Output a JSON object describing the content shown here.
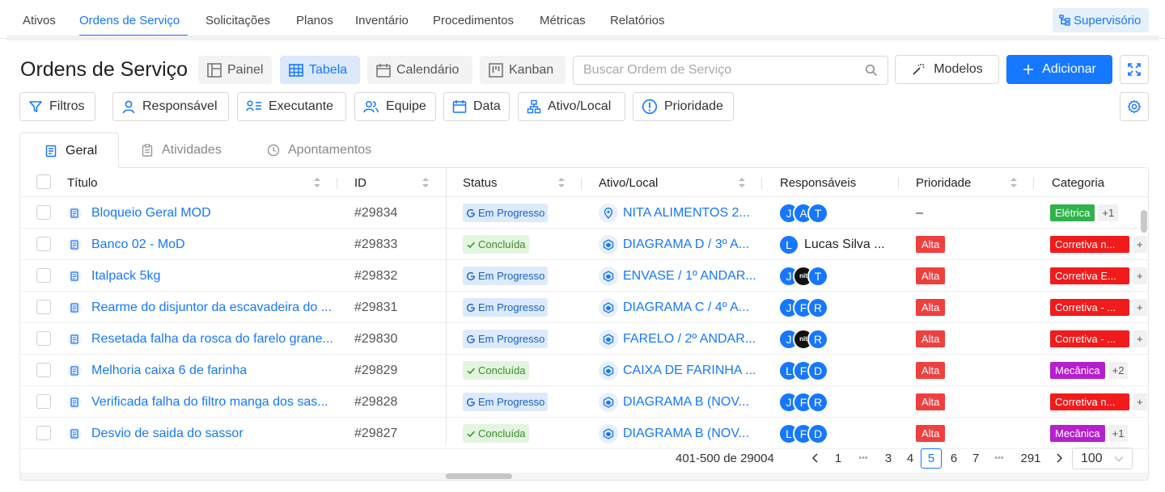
{
  "topnav": {
    "items": [
      "Ativos",
      "Ordens de Serviço",
      "Solicitações",
      "Planos",
      "Inventário",
      "Procedimentos",
      "Métricas",
      "Relatórios"
    ],
    "active": "Ordens de Serviço",
    "supervisor_label": "Supervisório"
  },
  "header": {
    "title": "Ordens de Serviço",
    "views": [
      "Painel",
      "Tabela",
      "Calendário",
      "Kanban"
    ],
    "active_view": "Tabela",
    "search_placeholder": "Buscar Ordem de Serviço",
    "models_label": "Modelos",
    "add_label": "Adicionar"
  },
  "filters": [
    "Filtros",
    "Responsável",
    "Executante",
    "Equipe",
    "Data",
    "Ativo/Local",
    "Prioridade"
  ],
  "tabs": [
    "Geral",
    "Atividades",
    "Apontamentos"
  ],
  "table": {
    "columns": [
      "Título",
      "ID",
      "Status",
      "Ativo/Local",
      "Responsáveis",
      "Prioridade",
      "Categoria"
    ],
    "rows": [
      {
        "title": "Bloqueio Geral MOD",
        "id": "#29834",
        "status": "Em Progresso",
        "asset": "NITA ALIMENTOS 2...",
        "asset_icon": "location-pin",
        "avatars": [
          "J",
          "A",
          "T"
        ],
        "avatar_name": "",
        "priority": "–",
        "category": "Elétrica",
        "category_type": "eletrica",
        "more": "+1"
      },
      {
        "title": "Banco 02 - MoD",
        "id": "#29833",
        "status": "Concluída",
        "asset": "DIAGRAMA D / 3º A...",
        "asset_icon": "asset-cube",
        "avatars": [
          "L"
        ],
        "avatar_name": "Lucas Silva ...",
        "priority": "Alta",
        "category": "Corretiva n...",
        "category_type": "corretiva",
        "more": "+"
      },
      {
        "title": "Italpack 5kg",
        "id": "#29832",
        "status": "Em Progresso",
        "asset": "ENVASE / 1º ANDAR...",
        "asset_icon": "asset-cube",
        "avatars": [
          "J",
          "nit",
          "T"
        ],
        "avatar_name": "",
        "priority": "Alta",
        "category": "Corretiva E...",
        "category_type": "corretiva",
        "more": "+"
      },
      {
        "title": "Rearme do disjuntor da escavadeira do ...",
        "id": "#29831",
        "status": "Em Progresso",
        "asset": "DIAGRAMA C / 4º A...",
        "asset_icon": "asset-cube",
        "avatars": [
          "J",
          "F",
          "R"
        ],
        "avatar_name": "",
        "priority": "Alta",
        "category": "Corretiva - ...",
        "category_type": "corretiva",
        "more": "+"
      },
      {
        "title": "Resetada falha da rosca do farelo grane...",
        "id": "#29830",
        "status": "Em Progresso",
        "asset": "FARELO / 2º ANDAR...",
        "asset_icon": "asset-cube",
        "avatars": [
          "J",
          "nit",
          "R"
        ],
        "avatar_name": "",
        "priority": "Alta",
        "category": "Corretiva - ...",
        "category_type": "corretiva",
        "more": "+"
      },
      {
        "title": "Melhoria caixa 6 de farinha",
        "id": "#29829",
        "status": "Concluída",
        "asset": "CAIXA DE FARINHA ...",
        "asset_icon": "asset-cube",
        "avatars": [
          "L",
          "F",
          "D"
        ],
        "avatar_name": "",
        "priority": "Alta",
        "category": "Mecânica",
        "category_type": "mecanica",
        "more": "+2"
      },
      {
        "title": "Verificada falha do filtro manga dos sas...",
        "id": "#29828",
        "status": "Em Progresso",
        "asset": "DIAGRAMA B (NOV...",
        "asset_icon": "asset-cube",
        "avatars": [
          "J",
          "F",
          "R"
        ],
        "avatar_name": "",
        "priority": "Alta",
        "category": "Corretiva n...",
        "category_type": "corretiva",
        "more": "+"
      },
      {
        "title": "Desvio de saida do sassor",
        "id": "#29827",
        "status": "Concluída",
        "asset": "DIAGRAMA B (NOV...",
        "asset_icon": "asset-cube",
        "avatars": [
          "L",
          "F",
          "D"
        ],
        "avatar_name": "",
        "priority": "Alta",
        "category": "Mecânica",
        "category_type": "mecanica",
        "more": "+1"
      }
    ]
  },
  "pagination": {
    "range": "401-500 de 29004",
    "pages": [
      "1",
      "•••",
      "3",
      "4",
      "5",
      "6",
      "7",
      "•••",
      "291"
    ],
    "current": "5",
    "page_size": "100"
  },
  "colors": {
    "accent": "#1677ff",
    "status_progress_bg": "#dceafb",
    "status_done_bg": "#e3f5df",
    "priority_high": "#ef4040",
    "cat_eletrica": "#2fb34a",
    "cat_corretiva": "#f21b1b",
    "cat_mecanica": "#b51fce"
  }
}
